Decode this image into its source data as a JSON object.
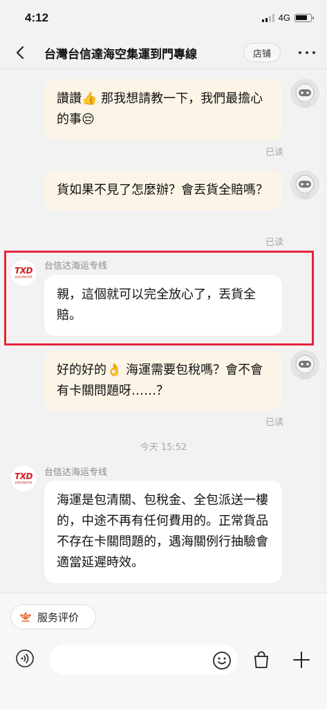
{
  "status": {
    "time": "4:12",
    "network": "4G"
  },
  "header": {
    "title": "台灣台信達海空集運到門專線",
    "shop_label": "店铺"
  },
  "messages": [
    {
      "dir": "out",
      "text_before": "讚讚",
      "emoji1": "👍",
      "text_mid": " 那我想請教一下，我們最擔心的事",
      "emoji2": "😔",
      "read": "已读"
    },
    {
      "dir": "out",
      "text": "貨如果不見了怎麼辦？會丟貨全賠嗎？",
      "read": "已读"
    },
    {
      "dir": "in",
      "sender": "台信达海运专线",
      "text": "親，這個就可以完全放心了，丟貨全賠。"
    },
    {
      "dir": "out",
      "text_before": "好的好的",
      "emoji1": "👌",
      "text_mid": " 海運需要包稅嗎？會不會有卡關問題呀……？",
      "read": "已读"
    },
    {
      "dir": "in",
      "sender": "台信达海运专线",
      "text": "海運是包清關、包稅金、全包派送一樓的，中途不再有任何費用的。正常貨品不存在卡關問題的，遇海關例行抽驗會適當延遲時效。"
    }
  ],
  "time_separator": "今天 15:52",
  "shop_logo": {
    "main": "TXD",
    "sub": "台信达海运专线"
  },
  "bottom": {
    "rate_label": "服务评价"
  },
  "colors": {
    "outgoing_bubble": "#fcf5e7",
    "incoming_bubble": "#ffffff",
    "highlight": "#e5243b"
  }
}
